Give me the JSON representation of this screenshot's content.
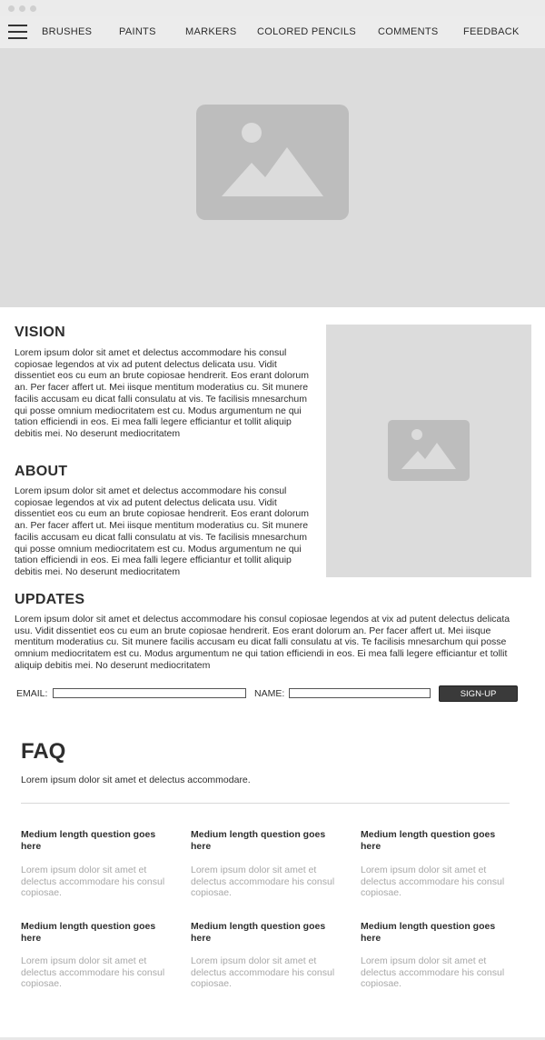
{
  "nav": {
    "items": [
      "BRUSHES",
      "PAINTS",
      "MARKERS",
      "COLORED PENCILS",
      "COMMENTS",
      "FEEDBACK"
    ]
  },
  "vision": {
    "title": "VISION",
    "body": "Lorem ipsum dolor sit amet et delectus accommodare his consul copiosae legendos at vix ad putent delectus delicata usu. Vidit dissentiet eos cu eum an brute copiosae hendrerit. Eos erant dolorum an. Per facer affert ut. Mei iisque mentitum moderatius cu. Sit munere facilis accusam eu dicat falli consulatu at vis. Te facilisis mnesarchum qui posse omnium mediocritatem est cu. Modus argumentum ne qui tation efficiendi in eos. Ei mea falli legere efficiantur et tollit aliquip debitis mei. No deserunt mediocritatem"
  },
  "about": {
    "title": "ABOUT",
    "body": "Lorem ipsum dolor sit amet et delectus accommodare his consul copiosae legendos at vix ad putent delectus delicata usu. Vidit dissentiet eos cu eum an brute copiosae hendrerit. Eos erant dolorum an. Per facer affert ut. Mei iisque mentitum moderatius cu. Sit munere facilis accusam eu dicat falli consulatu at vis. Te facilisis mnesarchum qui posse omnium mediocritatem est cu. Modus argumentum ne qui tation efficiendi in eos. Ei mea falli legere efficiantur et tollit aliquip debitis mei. No deserunt mediocritatem"
  },
  "updates": {
    "title": "UPDATES",
    "body": "Lorem ipsum dolor sit amet et delectus accommodare his consul copiosae legendos at vix ad putent delectus delicata usu. Vidit dissentiet eos cu eum an brute copiosae hendrerit. Eos erant dolorum an. Per facer affert ut. Mei iisque mentitum moderatius cu. Sit munere facilis accusam eu dicat falli consulatu at vis. Te facilisis mnesarchum qui posse omnium mediocritatem est cu. Modus argumentum ne qui tation efficiendi in eos. Ei mea falli legere efficiantur et tollit aliquip debitis mei. No deserunt mediocritatem"
  },
  "signup": {
    "email_label": "EMAIL:",
    "email_value": "",
    "name_label": "NAME:",
    "name_value": "",
    "button_label": "SIGN-UP"
  },
  "faq": {
    "title": "FAQ",
    "subtitle": "Lorem ipsum dolor sit amet et delectus accommodare.",
    "items": [
      {
        "question": "Medium length question goes here",
        "answer": "Lorem ipsum dolor sit amet et delectus accommodare his consul copiosae."
      },
      {
        "question": "Medium length question goes here",
        "answer": "Lorem ipsum dolor sit amet et delectus accommodare his consul copiosae."
      },
      {
        "question": "Medium length question goes here",
        "answer": "Lorem ipsum dolor sit amet et delectus accommodare his consul copiosae."
      },
      {
        "question": "Medium length question goes here",
        "answer": "Lorem ipsum dolor sit amet et delectus accommodare his consul copiosae."
      },
      {
        "question": "Medium length question goes here",
        "answer": "Lorem ipsum dolor sit amet et delectus accommodare his consul copiosae."
      },
      {
        "question": "Medium length question goes here",
        "answer": "Lorem ipsum dolor sit amet et delectus accommodare his consul copiosae."
      }
    ]
  },
  "colors": {
    "placeholder_bg": "#dcdcdc",
    "placeholder_icon": "#bdbdbd",
    "button_bg": "#3a3a3a",
    "answer_text": "#a8a8a8"
  },
  "icons": {
    "menu": "hamburger-menu-icon",
    "image": "image-placeholder-icon"
  }
}
